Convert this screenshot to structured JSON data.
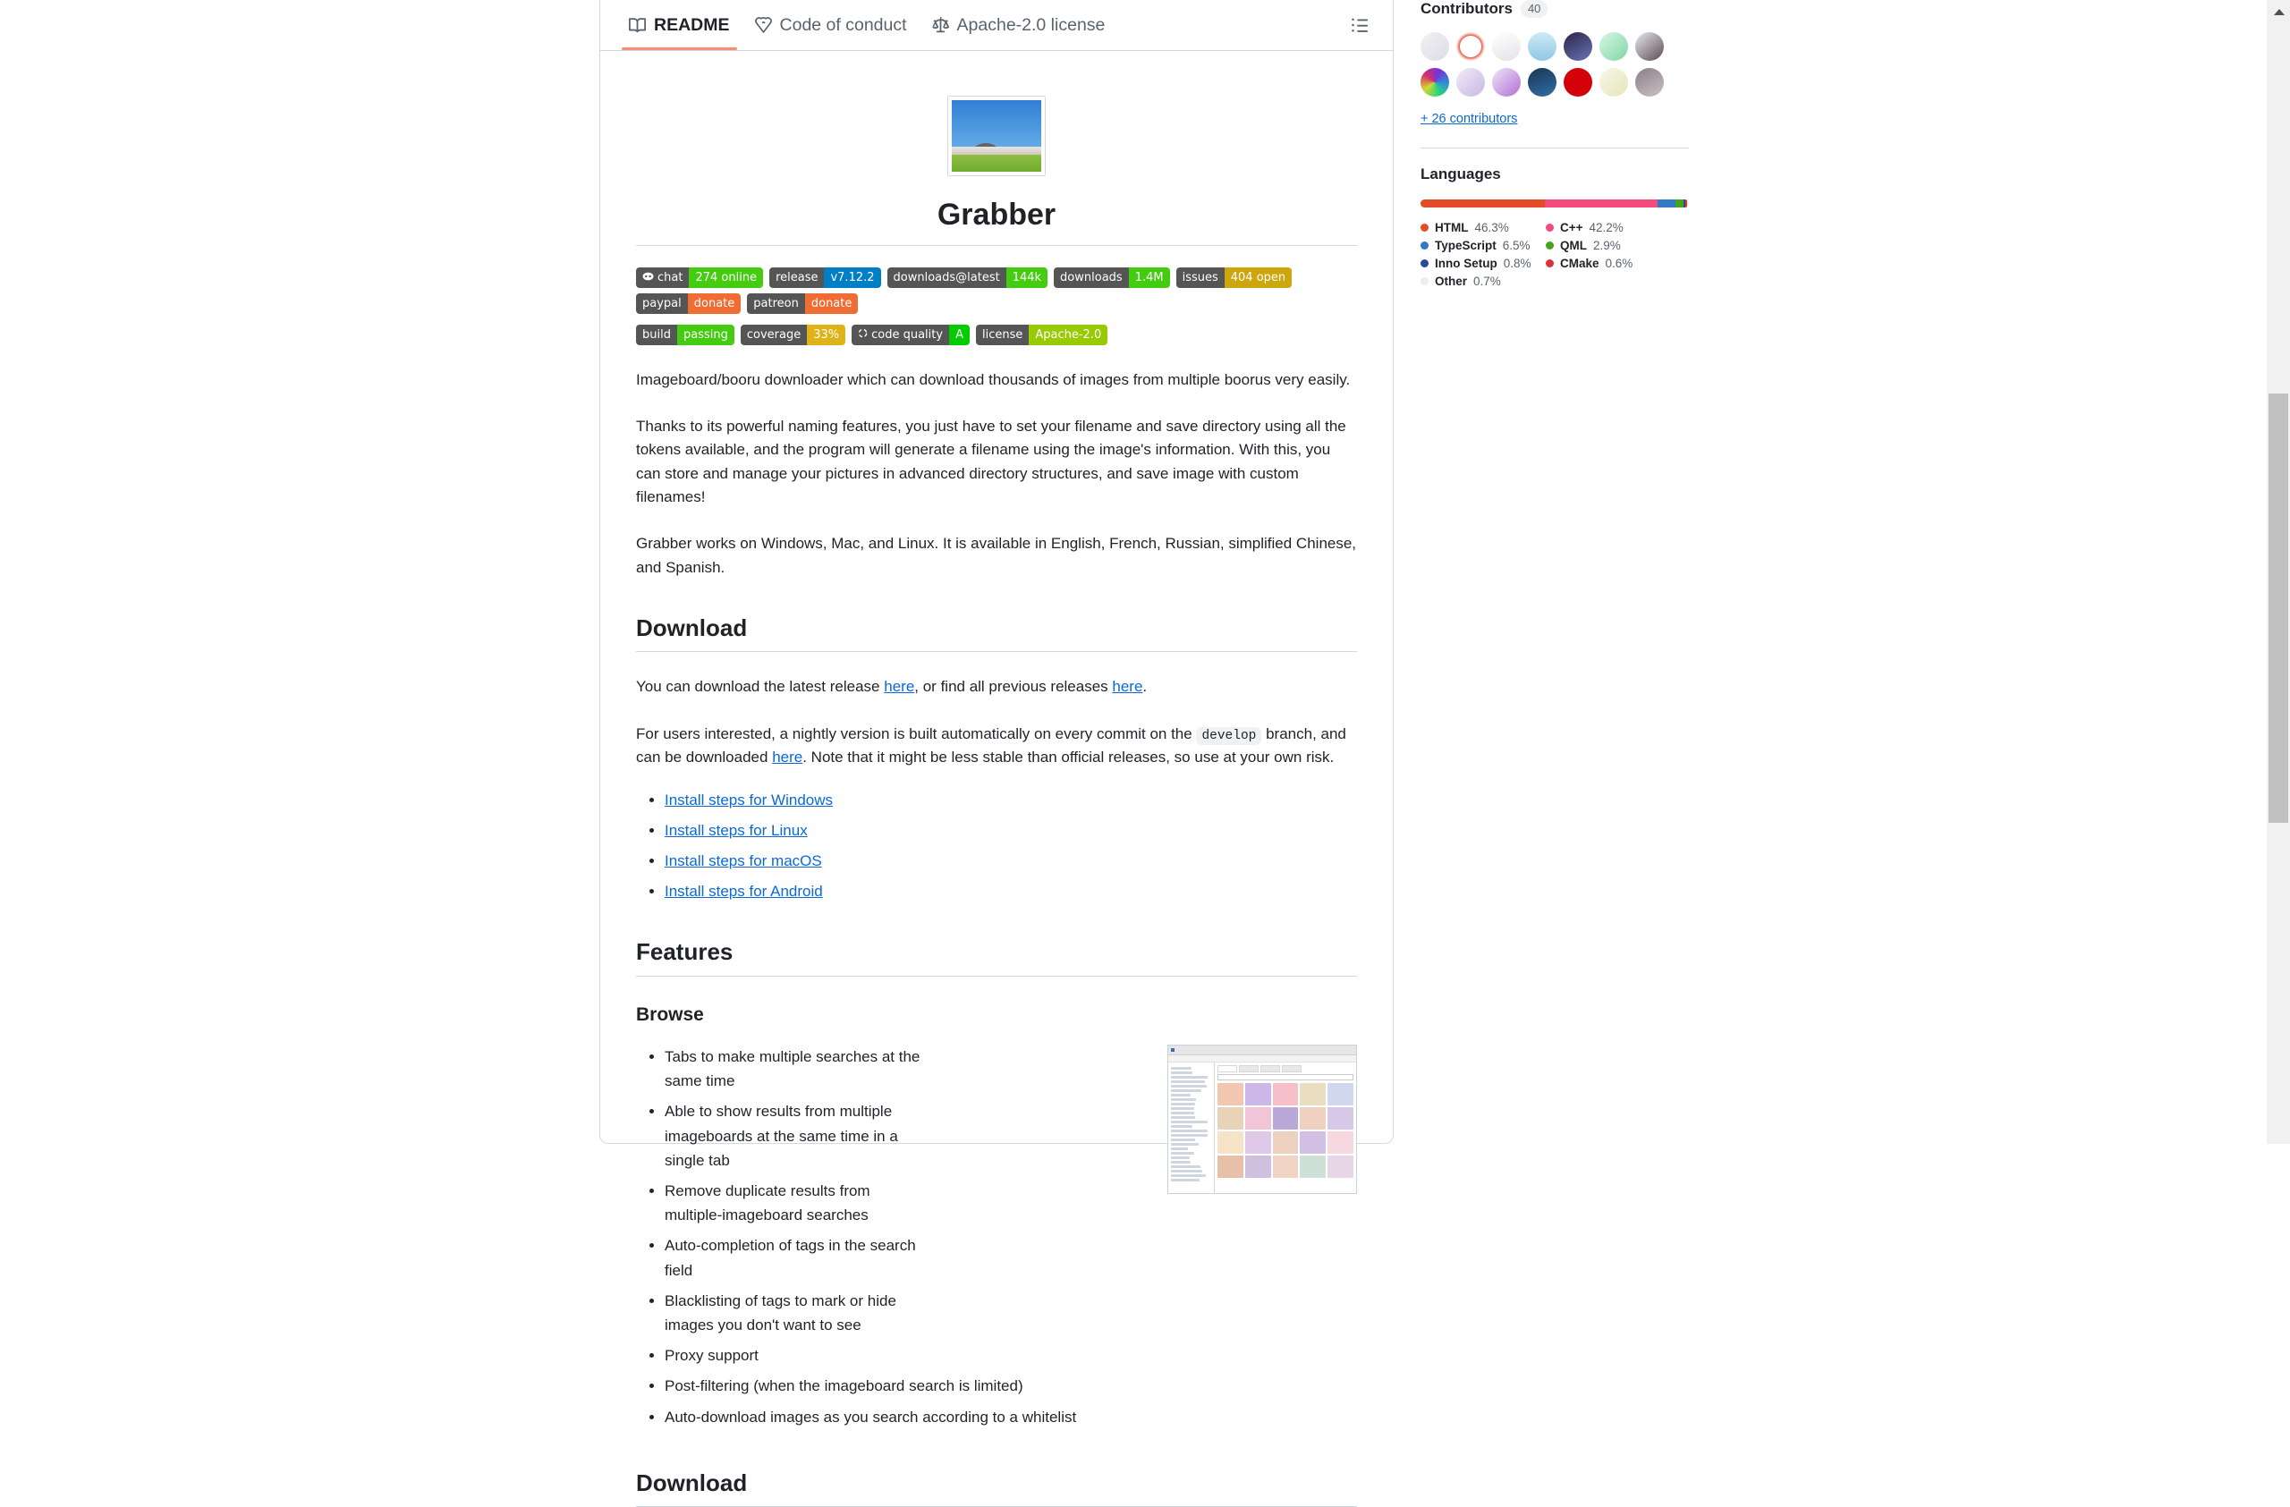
{
  "tabs": [
    {
      "label": "README",
      "icon": "book-icon",
      "active": true
    },
    {
      "label": "Code of conduct",
      "icon": "heart-shield-icon",
      "active": false
    },
    {
      "label": "Apache-2.0 license",
      "icon": "scales-icon",
      "active": false
    }
  ],
  "outline_button": {
    "name": "outline-icon",
    "label": "Outline"
  },
  "readme": {
    "title": "Grabber",
    "hero_alt": "Sugarloaf Mountain banner image",
    "badges": [
      {
        "left": "chat",
        "right": "274 online",
        "right_color": "#44cc11",
        "has_discord_icon": true
      },
      {
        "left": "release",
        "right": "v7.12.2",
        "right_color": "#007ec6"
      },
      {
        "left": "downloads@latest",
        "right": "144k",
        "right_color": "#4c1"
      },
      {
        "left": "downloads",
        "right": "1.4M",
        "right_color": "#4c1"
      },
      {
        "left": "issues",
        "right": "404 open",
        "right_color": "#cca60c"
      },
      {
        "left": "paypal",
        "right": "donate",
        "right_color": "#f06c32"
      },
      {
        "left": "patreon",
        "right": "donate",
        "right_color": "#f06c32"
      },
      {
        "left": "build",
        "right": "passing",
        "right_color": "#4c1"
      },
      {
        "left": "coverage",
        "right": "33%",
        "right_color": "#dfb317"
      },
      {
        "left": "code quality",
        "right": "A",
        "right_color": "#00cc00",
        "has_spinner_icon": true
      },
      {
        "left": "license",
        "right": "Apache-2.0",
        "right_color": "#97ca00"
      }
    ],
    "paragraphs": {
      "intro": "Imageboard/booru downloader which can download thousands of images from multiple boorus very easily.",
      "naming": "Thanks to its powerful naming features, you just have to set your filename and save directory using all the tokens available, and the program will generate a filename using the image's information. With this, you can store and manage your pictures in advanced directory structures, and save image with custom filenames!",
      "platforms": "Grabber works on Windows, Mac, and Linux. It is available in English, French, Russian, simplified Chinese, and Spanish."
    },
    "download_section": {
      "heading": "Download",
      "line1_a": "You can download the latest release ",
      "line1_link1": "here",
      "line1_b": ", or find all previous releases ",
      "line1_link2": "here",
      "line1_c": ".",
      "line2_a": "For users interested, a nightly version is built automatically on every commit on the ",
      "line2_code": "develop",
      "line2_b": " branch, and can be downloaded ",
      "line2_link": "here",
      "line2_c": ". Note that it might be less stable than official releases, so use at your own risk.",
      "install_links": [
        "Install steps for Windows",
        "Install steps for Linux",
        "Install steps for macOS",
        "Install steps for Android"
      ]
    },
    "features_section": {
      "heading": "Features",
      "subheading": "Browse",
      "bullets": [
        "Tabs to make multiple searches at the same time",
        "Able to show results from multiple imageboards at the same time in a single tab",
        "Remove duplicate results from multiple-imageboard searches",
        "Auto-completion of tags in the search field",
        "Blacklisting of tags to mark or hide images you don't want to see",
        "Proxy support",
        "Post-filtering (when the imageboard search is limited)",
        "Auto-download images as you search according to a whitelist"
      ],
      "screenshot_alt": "Grabber application browse window screenshot"
    },
    "bottom_heading": "Download"
  },
  "sidebar": {
    "contributors": {
      "title": "Contributors",
      "count": "40",
      "more_link": "+ 26 contributors",
      "avatars": [
        {
          "name": "contributor-avatar-1",
          "bg": "linear-gradient(135deg,#f2f2f4,#dcdce4)"
        },
        {
          "name": "contributor-avatar-2",
          "bg": "radial-gradient(circle at 50% 50%, #fff 52%, #e8604c 54%, #fdf0ee 70%)"
        },
        {
          "name": "contributor-avatar-3",
          "bg": "linear-gradient(160deg,#ffffff,#e3e3e6)"
        },
        {
          "name": "contributor-avatar-4",
          "bg": "linear-gradient(180deg,#cfeaf6,#8ec8e4)"
        },
        {
          "name": "contributor-avatar-5",
          "bg": "linear-gradient(150deg,#2a2448,#6b74b8)"
        },
        {
          "name": "contributor-avatar-6",
          "bg": "linear-gradient(135deg,#d9f5e4,#7fd6a6)"
        },
        {
          "name": "contributor-avatar-7",
          "bg": "linear-gradient(140deg,#e9e9ef,#5b4a52)"
        },
        {
          "name": "contributor-avatar-8",
          "bg": "conic-gradient(from 20deg,#7a2fd6,#2f8ed6,#2fd67a,#d6d62f,#d62f6a,#7a2fd6)"
        },
        {
          "name": "contributor-avatar-9",
          "bg": "linear-gradient(135deg,#f0ecf6,#c9b6e4)"
        },
        {
          "name": "contributor-avatar-10",
          "bg": "linear-gradient(135deg,#efe6f7,#b06fd6)"
        },
        {
          "name": "contributor-avatar-11",
          "bg": "linear-gradient(160deg,#1b3550,#2f6fa8)"
        },
        {
          "name": "contributor-avatar-12",
          "bg": "radial-gradient(circle at 50% 45%, #d4000a 70%, #a80008 100%)"
        },
        {
          "name": "contributor-avatar-13",
          "bg": "linear-gradient(135deg,#f7f7e8,#e6e6bb)"
        },
        {
          "name": "contributor-avatar-14",
          "bg": "linear-gradient(150deg,#8a7f86,#cdbfc6)"
        }
      ]
    },
    "languages": {
      "title": "Languages",
      "items": [
        {
          "name": "HTML",
          "pct": "46.3%",
          "value": 46.3,
          "color": "#e34c26"
        },
        {
          "name": "C++",
          "pct": "42.2%",
          "value": 42.2,
          "color": "#f34b7d"
        },
        {
          "name": "TypeScript",
          "pct": "6.5%",
          "value": 6.5,
          "color": "#3178c6"
        },
        {
          "name": "QML",
          "pct": "2.9%",
          "value": 2.9,
          "color": "#44a51c"
        },
        {
          "name": "Inno Setup",
          "pct": "0.8%",
          "value": 0.8,
          "color": "#264b99"
        },
        {
          "name": "CMake",
          "pct": "0.6%",
          "value": 0.6,
          "color": "#da3434"
        },
        {
          "name": "Other",
          "pct": "0.7%",
          "value": 0.7,
          "color": "#ededed"
        }
      ]
    }
  },
  "scrollbar": {
    "name": "page-scrollbar"
  }
}
